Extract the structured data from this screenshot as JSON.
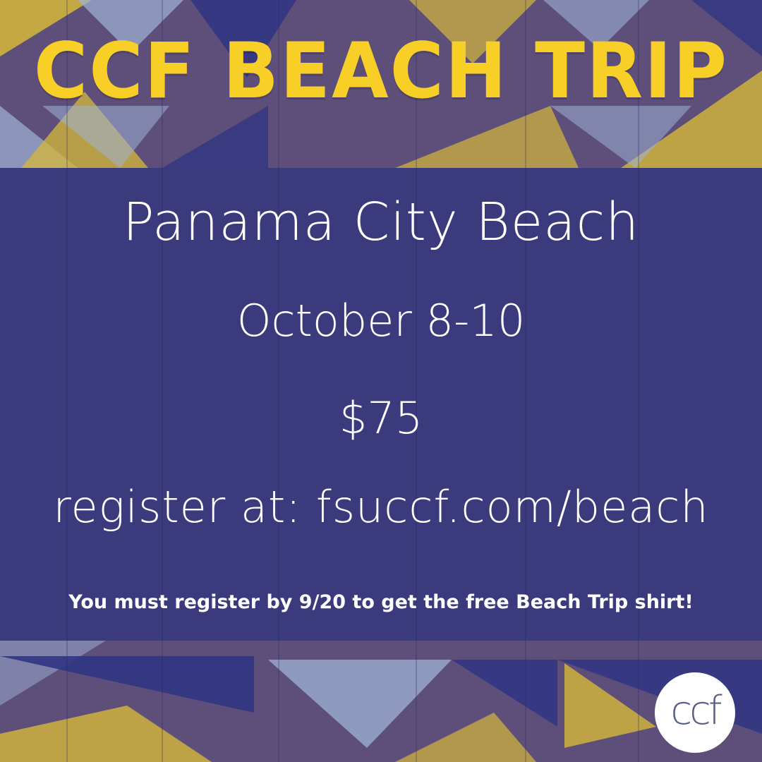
{
  "poster": {
    "title": "CCF BEACH TRIP",
    "location": "Panama City Beach",
    "dates": "October 8-10",
    "price": "$75",
    "register": "register at: fsuccf.com/beach",
    "note": "You must register by 9/20 to get the free Beach Trip shirt!",
    "logo_text": "ccf"
  },
  "colors": {
    "title": "#f7cf27",
    "panel": "#3a3a7d",
    "wood": "#5e4f7a",
    "tri_light": "#9fb3d6",
    "tri_yellow": "#d6b83a",
    "tri_navy": "#2f3582",
    "text": "#ffffff"
  }
}
